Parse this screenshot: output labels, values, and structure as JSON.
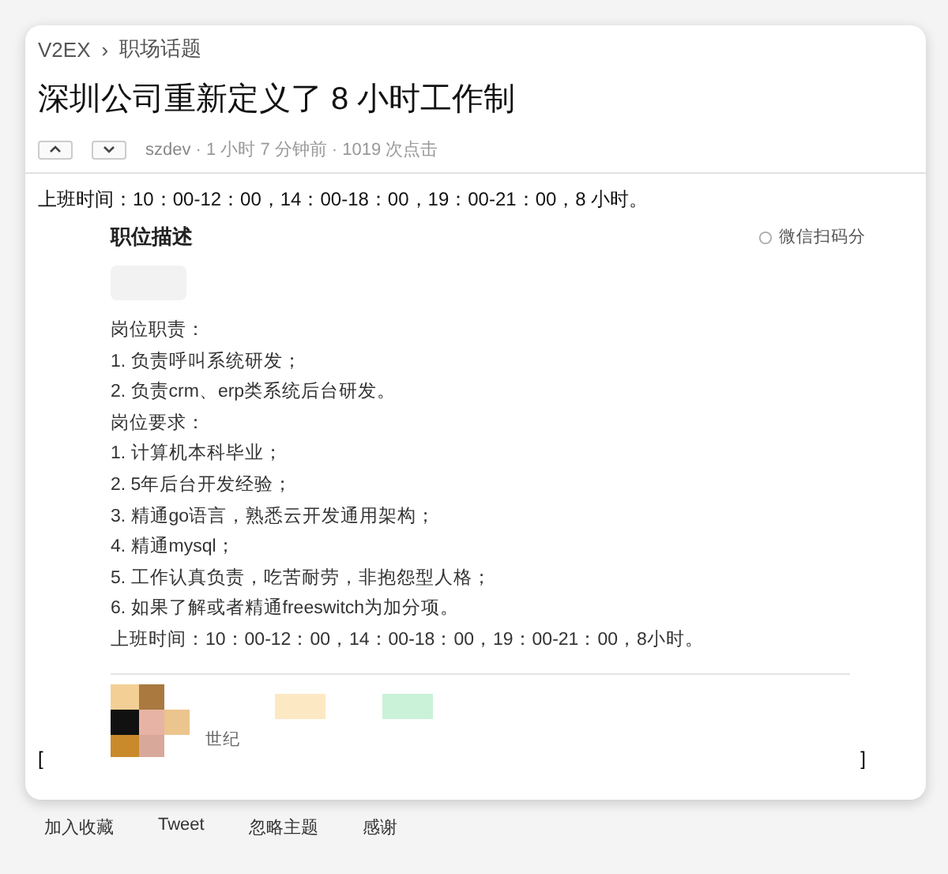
{
  "breadcrumb": {
    "site": "V2EX",
    "separator": "›",
    "node": "职场话题"
  },
  "title": "深圳公司重新定义了 8 小时工作制",
  "meta": {
    "author": "szdev",
    "info": "· 1 小时 7 分钟前 · 1019 次点击"
  },
  "body": "上班时间：10：00-12：00，14：00-18：00，19：00-21：00，8 小时。",
  "image": {
    "heading": "职位描述",
    "share": "微信扫码分",
    "lines": [
      "岗位职责：",
      "1. 负责呼叫系统研发；",
      "2. 负责crm、erp类系统后台研发。",
      "岗位要求：",
      "1. 计算机本科毕业；",
      "2. 5年后台开发经验；",
      "3. 精通go语言，熟悉云开发通用架构；",
      "4. 精通mysql；",
      "5. 工作认真负责，吃苦耐劳，非抱怨型人格；",
      "6. 如果了解或者精通freeswitch为加分项。",
      "上班时间：10：00-12：00，14：00-18：00，19：00-21：00，8小时。"
    ],
    "caption": "世纪"
  },
  "brackets": [
    "[",
    "]"
  ],
  "footer_links": [
    "加入收藏",
    "Tweet",
    "忽略主题",
    "感谢"
  ]
}
